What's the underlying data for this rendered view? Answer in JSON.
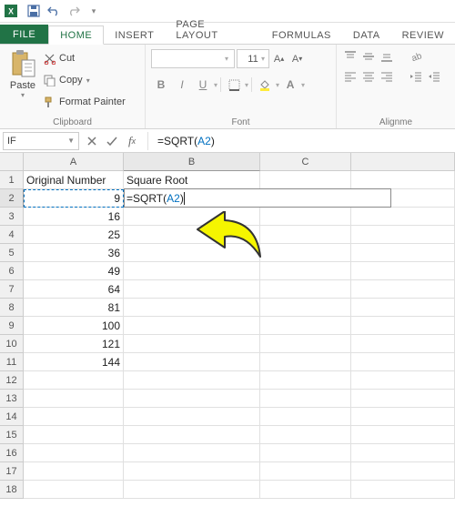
{
  "qat": {
    "save": "save-icon",
    "undo": "undo-icon",
    "redo": "redo-icon"
  },
  "tabs": {
    "file": "FILE",
    "home": "HOME",
    "insert": "INSERT",
    "page_layout": "PAGE LAYOUT",
    "formulas": "FORMULAS",
    "data": "DATA",
    "review": "REVIEW"
  },
  "ribbon": {
    "clipboard": {
      "paste": "Paste",
      "cut": "Cut",
      "copy": "Copy",
      "format_painter": "Format Painter",
      "label": "Clipboard"
    },
    "font": {
      "name": "",
      "size": "11",
      "label": "Font"
    },
    "alignment": {
      "label": "Alignme"
    }
  },
  "namebox": "IF",
  "formula_prefix": "=SQRT(",
  "formula_ref": "A2",
  "formula_suffix": ")",
  "columns": [
    "A",
    "B",
    "C"
  ],
  "headers": {
    "A": "Original Number",
    "B": "Square Root"
  },
  "chart_data": {
    "type": "table",
    "title": "Spreadsheet cells",
    "columns": [
      "Original Number",
      "Square Root"
    ],
    "rows": [
      [
        9,
        "=SQRT(A2)"
      ],
      [
        16,
        ""
      ],
      [
        25,
        ""
      ],
      [
        36,
        ""
      ],
      [
        49,
        ""
      ],
      [
        64,
        ""
      ],
      [
        81,
        ""
      ],
      [
        100,
        ""
      ],
      [
        121,
        ""
      ],
      [
        144,
        ""
      ]
    ]
  },
  "visible_rows": 18,
  "edit_row": 2,
  "edit_col": "B",
  "ref_cell": {
    "row": 2,
    "col": "A"
  }
}
